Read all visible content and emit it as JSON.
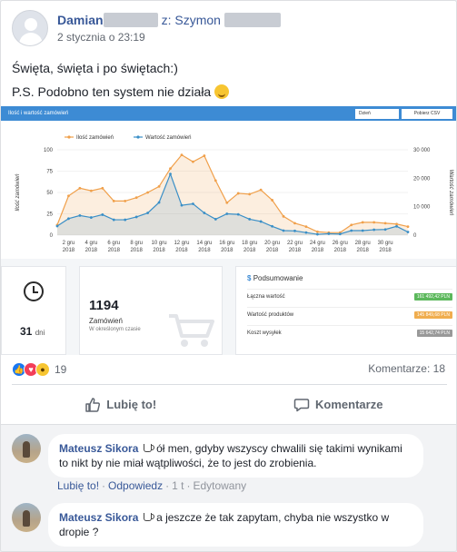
{
  "post": {
    "author": "Damian",
    "to_prefix": "z: Szymon",
    "timestamp": "2 stycznia o 23:19",
    "text_line1": "Święta, święta i po świętach:)",
    "text_line2": "P.S. Podobno ten system nie działa"
  },
  "screenshot": {
    "header_title": "Ilość i wartość zamówień",
    "select_value": "Dzień",
    "download_label": "Pobierz CSV",
    "orders_total": "1194",
    "orders_label": "Zamówień",
    "orders_sub": "W określonym czasie",
    "days_value": "31",
    "days_unit": "dni",
    "summary_title": "Podsumowanie",
    "summary_rows": [
      {
        "label": "Łączna wartość",
        "value": "161 492,42 PLN",
        "color": "#5cb85c"
      },
      {
        "label": "Wartość produktów",
        "value": "145 849,68 PLN",
        "color": "#f0ad4e"
      },
      {
        "label": "Koszt wysyłek",
        "value": "15 642,74 PLN",
        "color": "#999999"
      }
    ]
  },
  "chart_data": {
    "type": "line",
    "legend": [
      "Ilość zamówień",
      "Wartość zamówień"
    ],
    "ylabel_left": "Ilość zamówień",
    "ylabel_right": "Wartość zamówień",
    "ylim_left": [
      0,
      100
    ],
    "ylim_right": [
      0,
      30000
    ],
    "yticks_left": [
      "0",
      "25",
      "50",
      "75",
      "100"
    ],
    "yticks_right": [
      "0",
      "10 000",
      "20 000",
      "30 000"
    ],
    "x_ticks": [
      [
        "2 gru",
        "2018"
      ],
      [
        "4 gru",
        "2018"
      ],
      [
        "6 gru",
        "2018"
      ],
      [
        "8 gru",
        "2018"
      ],
      [
        "10 gru",
        "2018"
      ],
      [
        "12 gru",
        "2018"
      ],
      [
        "14 gru",
        "2018"
      ],
      [
        "16 gru",
        "2018"
      ],
      [
        "18 gru",
        "2018"
      ],
      [
        "20 gru",
        "2018"
      ],
      [
        "22 gru",
        "2018"
      ],
      [
        "24 gru",
        "2018"
      ],
      [
        "26 gru",
        "2018"
      ],
      [
        "28 gru",
        "2018"
      ],
      [
        "30 gru",
        "2018"
      ]
    ],
    "series": [
      {
        "name": "Ilość zamówień",
        "color": "#f0a04b",
        "values": [
          12,
          46,
          55,
          52,
          55,
          40,
          40,
          44,
          50,
          57,
          78,
          94,
          86,
          93,
          64,
          38,
          49,
          48,
          53,
          41,
          22,
          14,
          10,
          4,
          3,
          3,
          12,
          15,
          15,
          14,
          13,
          10
        ]
      },
      {
        "name": "Wartość zamówień",
        "color": "#3a8fc7",
        "values": [
          3200,
          5800,
          6900,
          6200,
          7200,
          5400,
          5400,
          6400,
          7800,
          11500,
          21500,
          10500,
          11000,
          7800,
          5600,
          7500,
          7300,
          5600,
          4800,
          3100,
          1600,
          1500,
          900,
          300,
          500,
          400,
          1600,
          1600,
          1900,
          2000,
          3100,
          1100
        ]
      }
    ]
  },
  "reactions": {
    "count": "19",
    "comments_label": "Komentarze: 18"
  },
  "actions": {
    "like_label": "Lubię to!",
    "comment_label": "Komentarze"
  },
  "comments": [
    {
      "author": "Mateusz Sikora",
      "text": "ół men, gdyby wszyscy chwalili się takimi wynikami to nikt by nie miał wątpliwości, że to jest do zrobienia.",
      "like": "Lubię to!",
      "reply": "Odpowiedz",
      "time": "1 t",
      "edited": "Edytowany"
    },
    {
      "author": "Mateusz Sikora",
      "text": "a jeszcze że tak zapytam, chyba nie wszystko w dropie ?"
    }
  ]
}
